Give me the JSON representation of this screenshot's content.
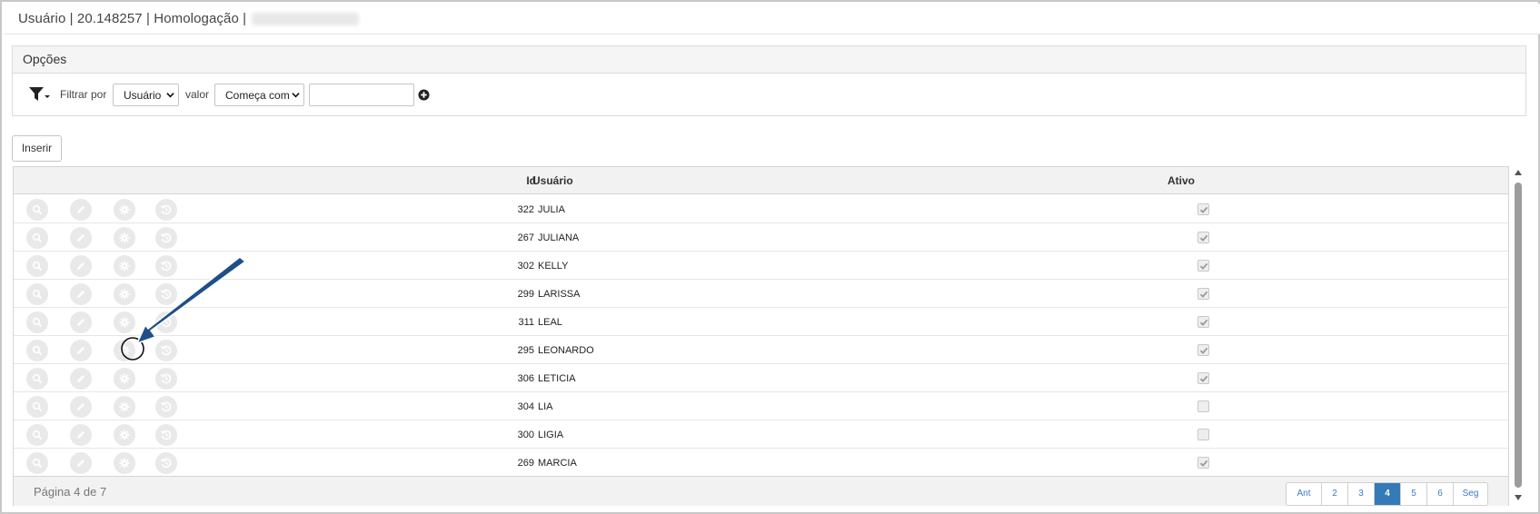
{
  "window": {
    "title": "Usuário | 20.148257 | Homologação |"
  },
  "options": {
    "heading": "Opções",
    "filter_by_label": "Filtrar por",
    "field_select": "Usuário",
    "value_label": "valor",
    "operator_select": "Começa com",
    "value_input": ""
  },
  "toolbar": {
    "insert_label": "Inserir"
  },
  "grid": {
    "columns": {
      "id": "Id",
      "user": "Usuário",
      "active": "Ativo"
    },
    "rows": [
      {
        "id": "322",
        "user": "JULIA",
        "active": true
      },
      {
        "id": "267",
        "user": "JULIANA",
        "active": true
      },
      {
        "id": "302",
        "user": "KELLY",
        "active": true
      },
      {
        "id": "299",
        "user": "LARISSA",
        "active": true
      },
      {
        "id": "311",
        "user": "LEAL",
        "active": true
      },
      {
        "id": "295",
        "user": "LEONARDO",
        "active": true
      },
      {
        "id": "306",
        "user": "LETICIA",
        "active": true
      },
      {
        "id": "304",
        "user": "LIA",
        "active": false
      },
      {
        "id": "300",
        "user": "LIGIA",
        "active": false
      },
      {
        "id": "269",
        "user": "MARCIA",
        "active": true
      }
    ],
    "row_actions": [
      "search-icon",
      "edit-icon",
      "gear-icon",
      "history-icon"
    ]
  },
  "pagination": {
    "page_info": "Página 4 de 7",
    "prev_label": "Ant",
    "pages": [
      "2",
      "3",
      "4",
      "5",
      "6"
    ],
    "current": "4",
    "next_label": "Seg"
  },
  "colors": {
    "accent": "#337ab7",
    "annotation_arrow": "#1f4f8a"
  }
}
